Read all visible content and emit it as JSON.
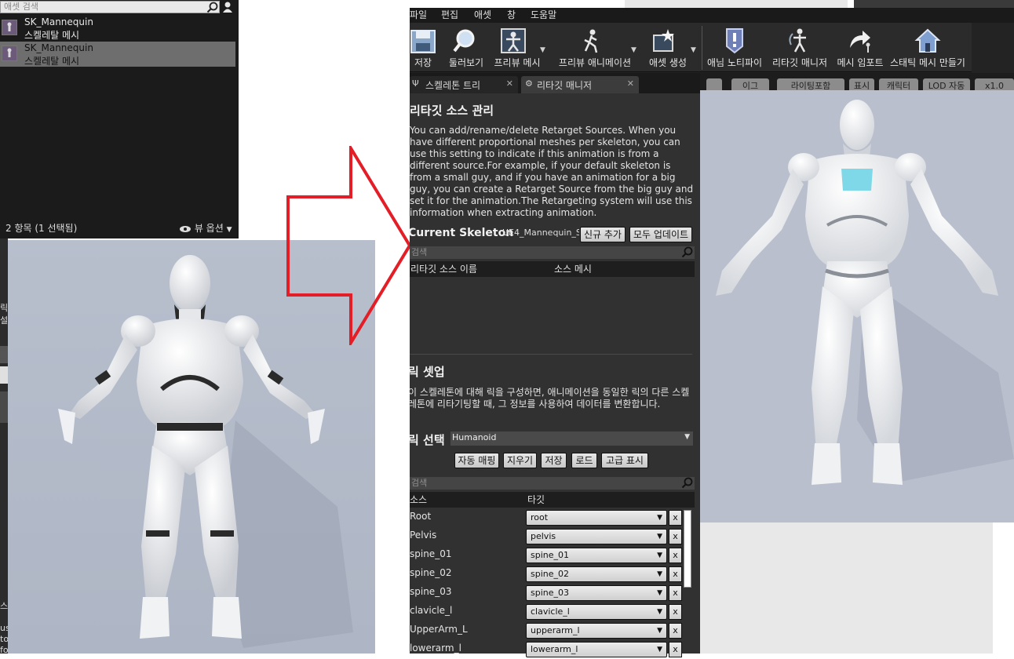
{
  "content_browser": {
    "search_placeholder": "애셋 검색",
    "assets": [
      {
        "name": "SK_Mannequin",
        "type": "스켈레탈 메시",
        "selected": false
      },
      {
        "name": "SK_Mannequin",
        "type": "스켈레탈 메시",
        "selected": true
      }
    ],
    "status": "2 항목 (1 선택됨)",
    "view_options": "뷰 옵션"
  },
  "left_strip_texts": [
    "릭",
    "설",
    "스",
    "us",
    "to",
    "fo"
  ],
  "menu": [
    "파일",
    "편집",
    "애셋",
    "창",
    "도움말"
  ],
  "toolbar": [
    {
      "label": "저장",
      "icon": "save-icon"
    },
    {
      "label": "둘러보기",
      "icon": "browse-icon"
    },
    {
      "label": "프리뷰 메시",
      "icon": "preview-mesh-icon"
    },
    {
      "label": "프리뷰 애니메이션",
      "icon": "preview-animation-icon"
    },
    {
      "label": "애셋 생성",
      "icon": "create-asset-icon"
    },
    {
      "label": "애님 노티파이",
      "icon": "anim-notify-icon"
    },
    {
      "label": "리타깃 매니저",
      "icon": "retarget-manager-icon"
    },
    {
      "label": "메시 임포트",
      "icon": "mesh-import-icon"
    },
    {
      "label": "스태틱 메시 만들기",
      "icon": "make-static-mesh-icon"
    }
  ],
  "tabs": [
    {
      "label": "스켈레톤 트리",
      "active": false
    },
    {
      "label": "리타깃 매니저",
      "active": true
    }
  ],
  "retarget_source": {
    "heading": "리타깃 소스 관리",
    "description": "You can add/rename/delete Retarget Sources. When you have different proportional meshes per skeleton, you can use this setting to indicate if this animation is from a different source.For example, if your default skeleton is from a small guy, and if you have an animation for a big guy, you can create a Retarget Source from the big guy and set it for the animation.The Retargeting system will use this information when extracting animation.",
    "current_skeleton_label": "Current Skeleton",
    "current_skeleton_value": "UE4_Mannequin_S",
    "add_new_button": "신규 추가",
    "update_all_button": "모두 업데이트",
    "search_placeholder": "검색",
    "col_name": "리타깃 소스 이름",
    "col_mesh": "소스 메시"
  },
  "rig_setup": {
    "heading": "릭 셋업",
    "description": "이 스켈레톤에 대해 릭을 구성하면, 애니메이션을 동일한 릭의 다른 스켈레톤에 리타기팅할 때, 그 정보를 사용하여 데이터를 변환합니다.",
    "select_rig_label": "릭 선택",
    "selected_rig": "Humanoid",
    "buttons": [
      "자동 매핑",
      "지우기",
      "저장",
      "로드",
      "고급 표시"
    ],
    "search_placeholder": "검색",
    "col_source": "소스",
    "col_target": "타깃",
    "bones": [
      {
        "source": "Root",
        "target": "root"
      },
      {
        "source": "Pelvis",
        "target": "pelvis"
      },
      {
        "source": "spine_01",
        "target": "spine_01"
      },
      {
        "source": "spine_02",
        "target": "spine_02"
      },
      {
        "source": "spine_03",
        "target": "spine_03"
      },
      {
        "source": "clavicle_l",
        "target": "clavicle_l"
      },
      {
        "source": "UpperArm_L",
        "target": "upperarm_l"
      },
      {
        "source": "lowerarm_l",
        "target": "lowerarm_l"
      }
    ],
    "remove_label": "x"
  },
  "viewport_tabs": [
    "이그",
    "라이팅포함",
    "표시",
    "캐릭터",
    "LOD 자동",
    "x1.0"
  ],
  "colors": {
    "panel_bg": "#313131",
    "viewport_bg": "#b9bfcc",
    "arrow": "#e41e26",
    "highlight_bone": "#7fd8e8"
  }
}
